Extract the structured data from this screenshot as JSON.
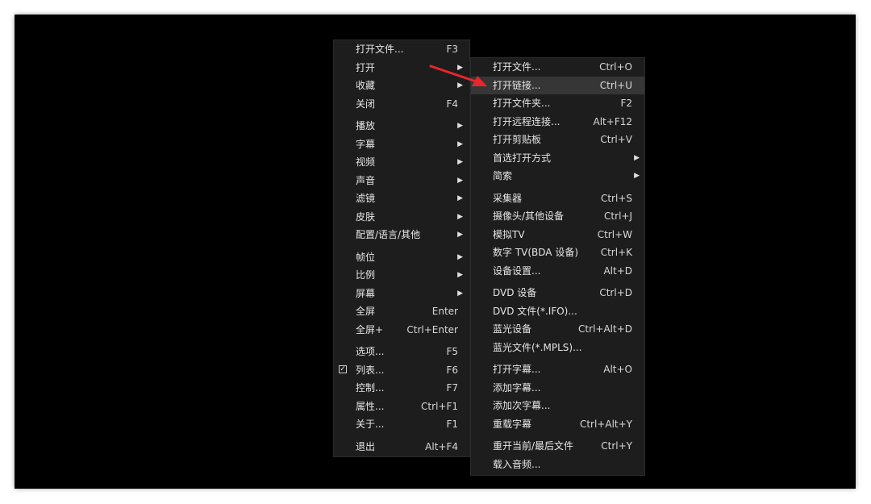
{
  "main_menu": [
    {
      "label": "打开文件...",
      "shortcut": "F3"
    },
    {
      "label": "打开",
      "arrow": "▶"
    },
    {
      "label": "收藏",
      "arrow": "▶"
    },
    {
      "label": "关闭",
      "shortcut": "F4"
    },
    {
      "sep": true
    },
    {
      "label": "播放",
      "arrow": "▶"
    },
    {
      "label": "字幕",
      "arrow": "▶"
    },
    {
      "label": "视频",
      "arrow": "▶"
    },
    {
      "label": "声音",
      "arrow": "▶"
    },
    {
      "label": "滤镜",
      "arrow": "▶"
    },
    {
      "label": "皮肤",
      "arrow": "▶"
    },
    {
      "label": "配置/语言/其他",
      "arrow": "▶"
    },
    {
      "sep": true
    },
    {
      "label": "帧位",
      "arrow": "▶"
    },
    {
      "label": "比例",
      "arrow": "▶"
    },
    {
      "label": "屏幕",
      "arrow": "▶"
    },
    {
      "label": "全屏",
      "shortcut": "Enter"
    },
    {
      "label": "全屏+",
      "shortcut": "Ctrl+Enter"
    },
    {
      "sep": true
    },
    {
      "label": "选项...",
      "shortcut": "F5"
    },
    {
      "label": "列表...",
      "shortcut": "F6",
      "checked": true
    },
    {
      "label": "控制...",
      "shortcut": "F7"
    },
    {
      "label": "属性...",
      "shortcut": "Ctrl+F1"
    },
    {
      "label": "关于...",
      "shortcut": "F1"
    },
    {
      "sep": true
    },
    {
      "label": "退出",
      "shortcut": "Alt+F4"
    }
  ],
  "open_submenu": [
    {
      "label": "打开文件...",
      "shortcut": "Ctrl+O"
    },
    {
      "label": "打开链接...",
      "shortcut": "Ctrl+U",
      "highlighted": true
    },
    {
      "label": "打开文件夹...",
      "shortcut": "F2"
    },
    {
      "label": "打开远程连接...",
      "shortcut": "Alt+F12"
    },
    {
      "label": "打开剪贴板",
      "shortcut": "Ctrl+V"
    },
    {
      "label": "首选打开方式",
      "arrow": "▶"
    },
    {
      "label": "简索",
      "arrow": "▶"
    },
    {
      "sep": true
    },
    {
      "label": "采集器",
      "shortcut": "Ctrl+S"
    },
    {
      "label": "摄像头/其他设备",
      "shortcut": "Ctrl+J"
    },
    {
      "label": "模拟TV",
      "shortcut": "Ctrl+W"
    },
    {
      "label": "数字 TV(BDA 设备)",
      "shortcut": "Ctrl+K"
    },
    {
      "label": "设备设置...",
      "shortcut": "Alt+D"
    },
    {
      "sep": true
    },
    {
      "label": "DVD 设备",
      "shortcut": "Ctrl+D"
    },
    {
      "label": "DVD 文件(*.IFO)..."
    },
    {
      "label": "蓝光设备",
      "shortcut": "Ctrl+Alt+D"
    },
    {
      "label": "蓝光文件(*.MPLS)..."
    },
    {
      "sep": true
    },
    {
      "label": "打开字幕...",
      "shortcut": "Alt+O"
    },
    {
      "label": "添加字幕..."
    },
    {
      "label": "添加次字幕..."
    },
    {
      "label": "重载字幕",
      "shortcut": "Ctrl+Alt+Y"
    },
    {
      "sep": true
    },
    {
      "label": "重开当前/最后文件",
      "shortcut": "Ctrl+Y"
    },
    {
      "label": "载入音频..."
    }
  ],
  "colors": {
    "menu_bg": "#1d1d1d",
    "highlight": "#363636",
    "text": "#e6e6e6",
    "annotation_arrow": "#e8262b"
  }
}
